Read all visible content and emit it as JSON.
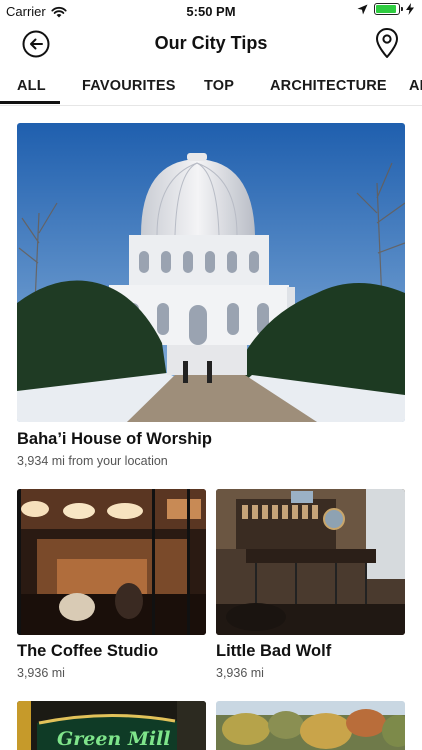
{
  "status_bar": {
    "carrier": "Carrier",
    "time": "5:50 PM",
    "battery_level": 0.9,
    "battery_color": "#2ecc40"
  },
  "nav": {
    "title": "Our City Tips",
    "back_icon": "back-arrow-circle-icon",
    "map_icon": "map-pin-icon"
  },
  "tabs": [
    {
      "label": "ALL",
      "active": true
    },
    {
      "label": "FAVOURITES",
      "active": false
    },
    {
      "label": "TOP",
      "active": false
    },
    {
      "label": "ARCHITECTURE",
      "active": false
    },
    {
      "label": "AR",
      "active": false
    }
  ],
  "tips": [
    {
      "title": "Baha’i House of Worship",
      "subtitle": "3,934 mi from your location"
    },
    {
      "title": "The Coffee Studio",
      "subtitle": "3,936 mi"
    },
    {
      "title": "Little Bad Wolf",
      "subtitle": "3,936 mi"
    },
    {
      "title": "",
      "subtitle": "",
      "sign_text": "Green Mill"
    },
    {
      "title": "",
      "subtitle": ""
    }
  ]
}
